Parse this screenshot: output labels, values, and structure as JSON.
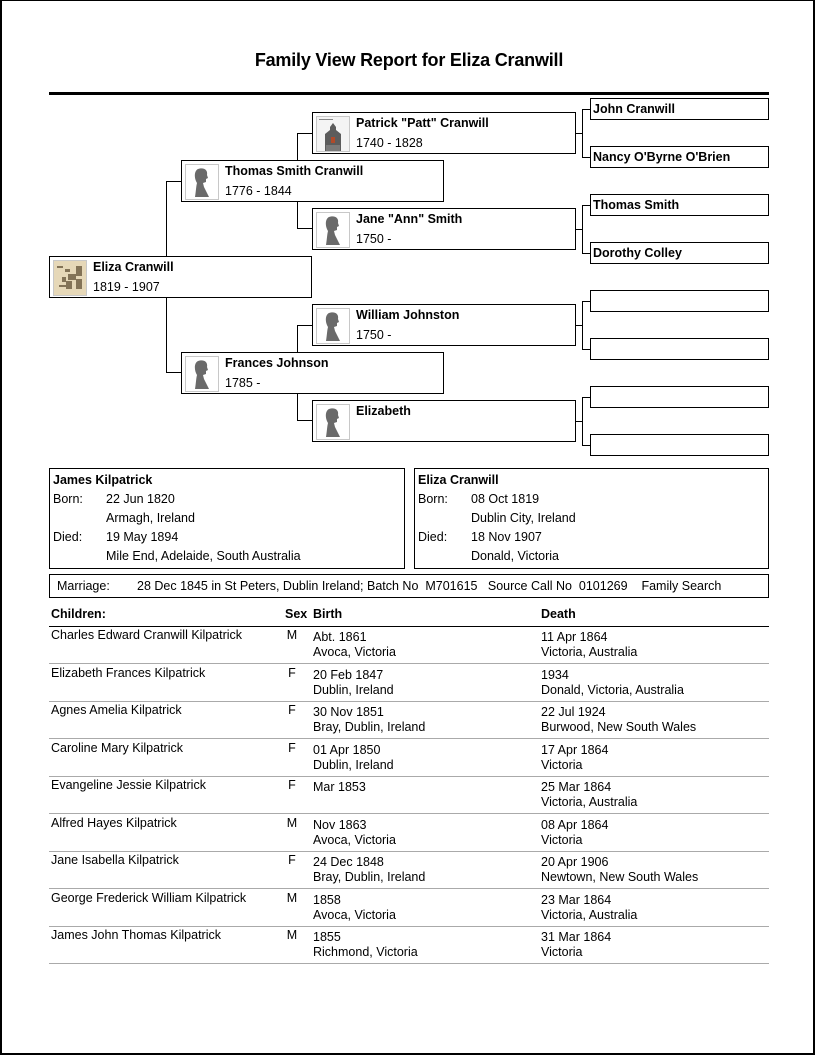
{
  "report": {
    "title": "Family View Report for Eliza Cranwill"
  },
  "pedigree": {
    "root": {
      "name": "Eliza Cranwill",
      "dates": "1819 - 1907",
      "photo": "map-image"
    },
    "father": {
      "name": "Thomas Smith Cranwill",
      "dates": "1776 - 1844",
      "photo": "silhouette"
    },
    "mother": {
      "name": "Frances Johnson",
      "dates": "1785 -",
      "photo": "silhouette"
    },
    "paternal_grandfather": {
      "name": "Patrick \"Patt\" Cranwill",
      "dates": "1740 - 1828",
      "photo": "church-image"
    },
    "paternal_grandmother": {
      "name": "Jane \"Ann\" Smith",
      "dates": "1750 -",
      "photo": "silhouette"
    },
    "maternal_grandfather": {
      "name": "William Johnston",
      "dates": "1750 -",
      "photo": "silhouette"
    },
    "maternal_grandmother": {
      "name": "Elizabeth",
      "dates": "",
      "photo": "silhouette"
    },
    "great_grandparents": [
      {
        "name": "John Cranwill"
      },
      {
        "name": "Nancy O'Byrne O'Brien"
      },
      {
        "name": "Thomas Smith"
      },
      {
        "name": "Dorothy Colley"
      },
      {
        "name": ""
      },
      {
        "name": ""
      },
      {
        "name": ""
      },
      {
        "name": ""
      }
    ]
  },
  "husband": {
    "name": "James Kilpatrick",
    "born_label": "Born:",
    "born_date": "22 Jun 1820",
    "born_place": "Armagh, Ireland",
    "died_label": "Died:",
    "died_date": "19 May 1894",
    "died_place": "Mile End, Adelaide, South Australia"
  },
  "wife": {
    "name": "Eliza Cranwill",
    "born_label": "Born:",
    "born_date": "08 Oct 1819",
    "born_place": "Dublin City, Ireland",
    "died_label": "Died:",
    "died_date": "18 Nov 1907",
    "died_place": "Donald, Victoria"
  },
  "marriage": {
    "label": "Marriage:",
    "value": "28 Dec 1845 in St Peters, Dublin Ireland; Batch No  M701615   Source Call No  0101269    Family Search"
  },
  "children_table": {
    "headers": {
      "name": "Children:",
      "sex": "Sex",
      "birth": "Birth",
      "death": "Death"
    },
    "rows": [
      {
        "name": "Charles Edward Cranwill Kilpatrick",
        "sex": "M",
        "birth_date": "Abt. 1861",
        "birth_place": "Avoca, Victoria",
        "death_date": "11 Apr 1864",
        "death_place": "Victoria, Australia"
      },
      {
        "name": "Elizabeth Frances Kilpatrick",
        "sex": "F",
        "birth_date": "20 Feb 1847",
        "birth_place": "Dublin, Ireland",
        "death_date": "1934",
        "death_place": "Donald, Victoria, Australia"
      },
      {
        "name": "Agnes Amelia Kilpatrick",
        "sex": "F",
        "birth_date": "30 Nov 1851",
        "birth_place": "Bray, Dublin, Ireland",
        "death_date": "22 Jul 1924",
        "death_place": "Burwood, New South Wales"
      },
      {
        "name": "Caroline Mary Kilpatrick",
        "sex": "F",
        "birth_date": "01 Apr 1850",
        "birth_place": "Dublin, Ireland",
        "death_date": "17 Apr 1864",
        "death_place": "Victoria"
      },
      {
        "name": "Evangeline Jessie Kilpatrick",
        "sex": "F",
        "birth_date": "Mar 1853",
        "birth_place": "",
        "death_date": "25 Mar 1864",
        "death_place": "Victoria, Australia"
      },
      {
        "name": "Alfred Hayes Kilpatrick",
        "sex": "M",
        "birth_date": "Nov 1863",
        "birth_place": "Avoca, Victoria",
        "death_date": "08 Apr 1864",
        "death_place": "Victoria"
      },
      {
        "name": "Jane Isabella Kilpatrick",
        "sex": "F",
        "birth_date": "24 Dec 1848",
        "birth_place": "Bray, Dublin, Ireland",
        "death_date": "20 Apr 1906",
        "death_place": "Newtown, New South Wales"
      },
      {
        "name": "George Frederick William Kilpatrick",
        "sex": "M",
        "birth_date": "1858",
        "birth_place": "Avoca, Victoria",
        "death_date": "23 Mar 1864",
        "death_place": "Victoria, Australia"
      },
      {
        "name": "James John Thomas Kilpatrick",
        "sex": "M",
        "birth_date": "1855",
        "birth_place": "Richmond, Victoria",
        "death_date": "31 Mar 1864",
        "death_place": "Victoria"
      }
    ]
  }
}
